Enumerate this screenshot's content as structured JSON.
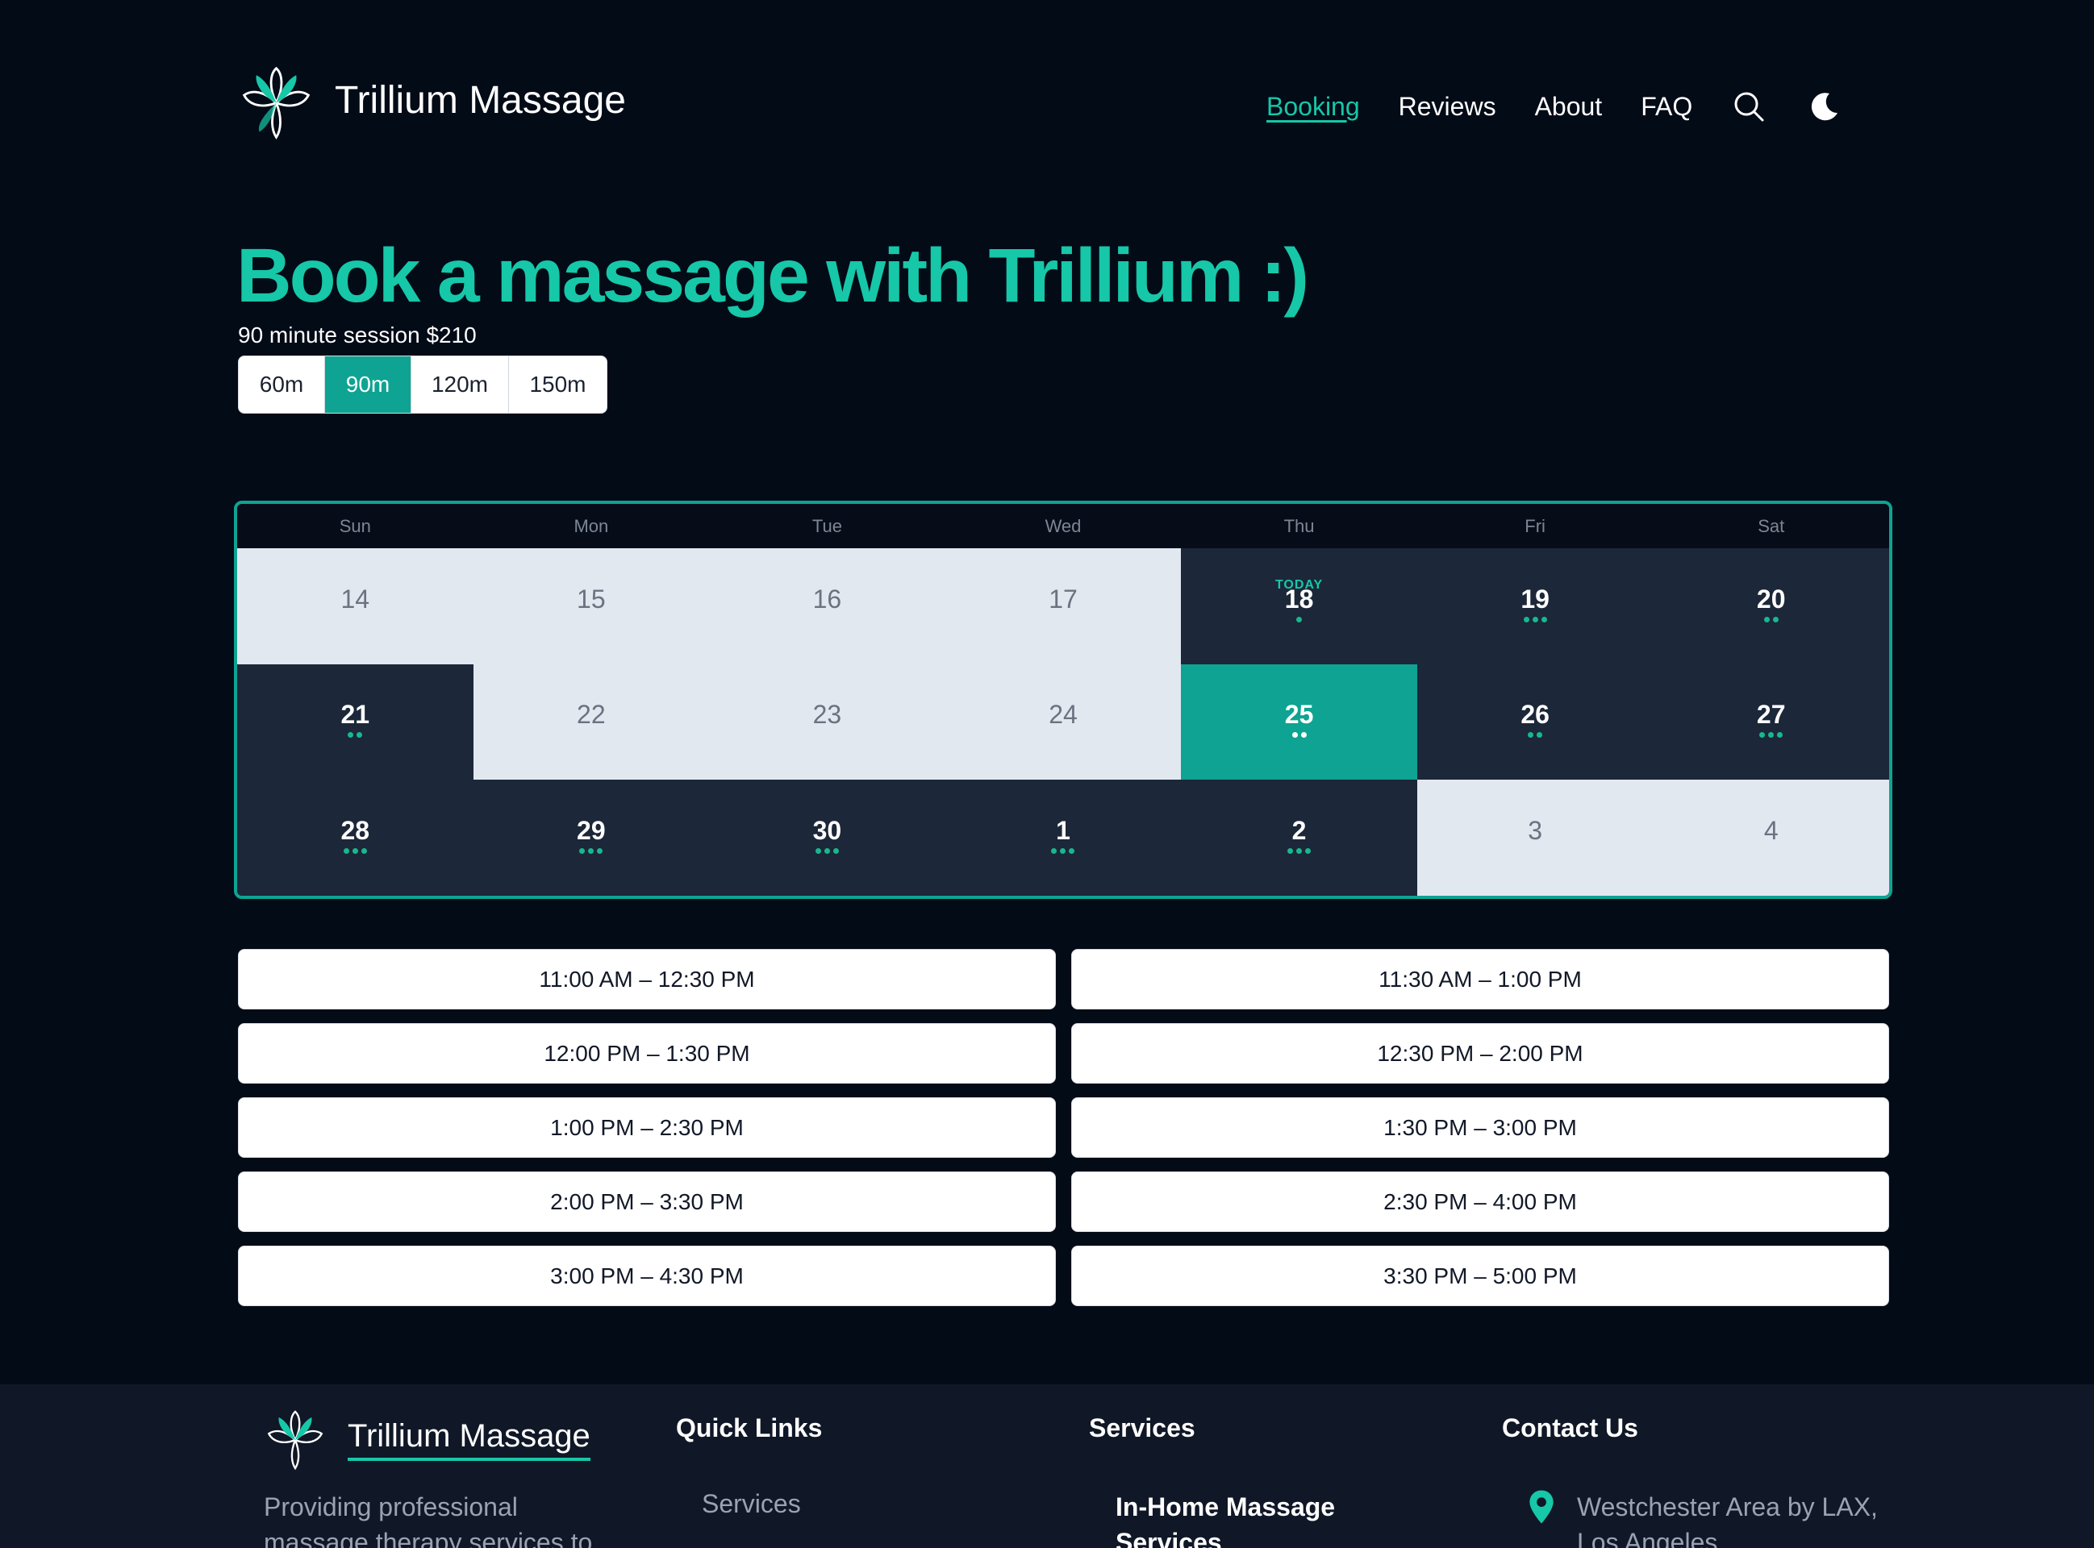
{
  "header": {
    "brand": "Trillium Massage",
    "nav": [
      "Booking",
      "Reviews",
      "About",
      "FAQ"
    ],
    "active_nav": "Booking",
    "icons": [
      "search-icon",
      "moon-icon"
    ]
  },
  "hero": {
    "title": "Book a massage with Trillium :)",
    "subtitle": "90 minute session $210",
    "durations": [
      "60m",
      "90m",
      "120m",
      "150m"
    ],
    "selected_duration": "90m"
  },
  "calendar": {
    "weekdays": [
      "Sun",
      "Mon",
      "Tue",
      "Wed",
      "Thu",
      "Fri",
      "Sat"
    ],
    "today_label": "TODAY",
    "days": [
      {
        "label": "14",
        "state": "off",
        "dots": 0
      },
      {
        "label": "15",
        "state": "off",
        "dots": 0
      },
      {
        "label": "16",
        "state": "off",
        "dots": 0
      },
      {
        "label": "17",
        "state": "off",
        "dots": 0
      },
      {
        "label": "18",
        "state": "open",
        "dots": 1,
        "today": true
      },
      {
        "label": "19",
        "state": "open",
        "dots": 3
      },
      {
        "label": "20",
        "state": "open",
        "dots": 2
      },
      {
        "label": "21",
        "state": "open",
        "dots": 2
      },
      {
        "label": "22",
        "state": "off",
        "dots": 0
      },
      {
        "label": "23",
        "state": "off",
        "dots": 0
      },
      {
        "label": "24",
        "state": "off",
        "dots": 0
      },
      {
        "label": "25",
        "state": "selected",
        "dots": 2
      },
      {
        "label": "26",
        "state": "open",
        "dots": 2
      },
      {
        "label": "27",
        "state": "open",
        "dots": 3
      },
      {
        "label": "28",
        "state": "open",
        "dots": 3
      },
      {
        "label": "29",
        "state": "open",
        "dots": 3
      },
      {
        "label": "30",
        "state": "open",
        "dots": 3
      },
      {
        "label": "1",
        "state": "open",
        "dots": 3
      },
      {
        "label": "2",
        "state": "open",
        "dots": 3
      },
      {
        "label": "3",
        "state": "off",
        "dots": 0
      },
      {
        "label": "4",
        "state": "off",
        "dots": 0
      }
    ]
  },
  "slots": [
    "11:00 AM – 12:30 PM",
    "11:30 AM – 1:00 PM",
    "12:00 PM – 1:30 PM",
    "12:30 PM – 2:00 PM",
    "1:00 PM – 2:30 PM",
    "1:30 PM – 3:00 PM",
    "2:00 PM – 3:30 PM",
    "2:30 PM – 4:00 PM",
    "3:00 PM – 4:30 PM",
    "3:30 PM – 5:00 PM"
  ],
  "footer": {
    "brand": "Trillium Massage",
    "description": "Providing professional massage therapy services to",
    "quick_links_title": "Quick Links",
    "quick_links": [
      "Services"
    ],
    "services_title": "Services",
    "services": [
      "In-Home Massage Services"
    ],
    "contact_title": "Contact Us",
    "address": "Westchester Area by LAX, Los Angeles"
  },
  "colors": {
    "background": "#030b17",
    "accent": "#16c7a8",
    "selected": "#0ea392",
    "open_day": "#1c2739",
    "off_day": "#e2e8f0",
    "footer": "#101727"
  }
}
